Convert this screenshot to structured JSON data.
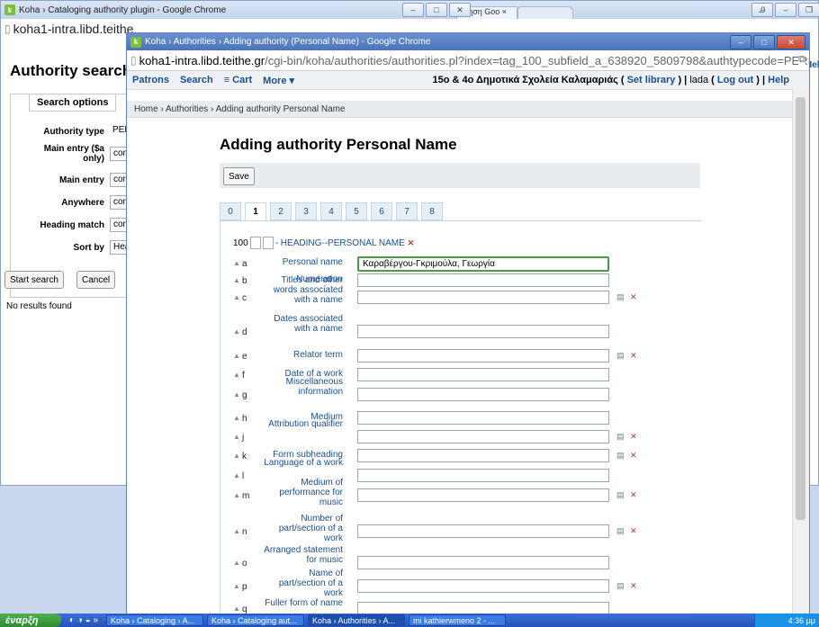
{
  "back_window": {
    "title": "Koha › Cataloging authority plugin - Google Chrome",
    "tab_label": "πηση Goo ×",
    "url": "koha1-intra.libd.teithe",
    "heading": "Authority search",
    "search_options": {
      "legend": "Search options",
      "rows": [
        {
          "label": "Authority type",
          "value": "PERS("
        },
        {
          "label": "Main entry ($a only)",
          "value": "conta"
        },
        {
          "label": "Main entry",
          "value": "conta"
        },
        {
          "label": "Anywhere",
          "value": "conta"
        },
        {
          "label": "Heading match",
          "value": "conta"
        },
        {
          "label": "Sort by",
          "value": "Head"
        }
      ]
    },
    "start_search": "Start search",
    "cancel": "Cancel",
    "no_results": "No results found",
    "right_strip": "Hel"
  },
  "front_window": {
    "title": "Koha › Authorities › Adding authority (Personal Name) - Google Chrome",
    "url_host": "koha1-intra.libd.teithe.gr",
    "url_path": "/cgi-bin/koha/authorities/authorities.pl?index=tag_100_subfield_a_638920_5809798&authtypecode=PERSO_NAME",
    "nav": {
      "patrons": "Patrons",
      "search": "Search",
      "cart": "≡ Cart",
      "more": "More ▾",
      "library": "15ο & 4ο Δημοτικά Σχολεία Καλαμαριάς",
      "set_library": "Set library",
      "user": "lada",
      "logout": "Log out",
      "help": "Help"
    },
    "breadcrumb": "Home › Authorities › Adding authority Personal Name",
    "page_title": "Adding authority Personal Name",
    "save": "Save",
    "tabs": [
      "0",
      "1",
      "2",
      "3",
      "4",
      "5",
      "6",
      "7",
      "8"
    ],
    "active_tab": "1",
    "field_tag": "100",
    "field_heading": "- HEADING--PERSONAL NAME",
    "subfields": [
      {
        "code": "a",
        "label": "Personal name",
        "value": "Καραβέργου-Γκριμούλα, Γεωργία",
        "icons": false
      },
      {
        "code": "b",
        "label": "Numeration",
        "value": "",
        "icons": false
      },
      {
        "code": "c",
        "label": "Titles and other words associated with a name",
        "value": "",
        "icons": true
      },
      {
        "code": "d",
        "label": "Dates associated with a name",
        "value": "",
        "icons": false
      },
      {
        "code": "e",
        "label": "Relator term",
        "value": "",
        "icons": true
      },
      {
        "code": "f",
        "label": "Date of a work",
        "value": "",
        "icons": false
      },
      {
        "code": "g",
        "label": "Miscellaneous information",
        "value": "",
        "icons": false
      },
      {
        "code": "h",
        "label": "Medium",
        "value": "",
        "icons": false
      },
      {
        "code": "j",
        "label": "Attribution qualifier",
        "value": "",
        "icons": true
      },
      {
        "code": "k",
        "label": "Form subheading",
        "value": "",
        "icons": true
      },
      {
        "code": "l",
        "label": "Language of a work",
        "value": "",
        "icons": false
      },
      {
        "code": "m",
        "label": "Medium of performance for music",
        "value": "",
        "icons": true
      },
      {
        "code": "n",
        "label": "Number of part/section of a work",
        "value": "",
        "icons": true
      },
      {
        "code": "o",
        "label": "Arranged statement for music",
        "value": "",
        "icons": false
      },
      {
        "code": "p",
        "label": "Name of part/section of a work",
        "value": "",
        "icons": true
      },
      {
        "code": "q",
        "label": "Fuller form of name",
        "value": "",
        "icons": false
      }
    ]
  },
  "taskbar": {
    "start": "έναρξη",
    "tasks": [
      "Koha › Cataloging › A...",
      "Koha › Cataloging aut...",
      "Koha › Authorities › A...",
      "mi kathierwmeno 2 - ..."
    ],
    "clock": "4:36 μμ"
  }
}
